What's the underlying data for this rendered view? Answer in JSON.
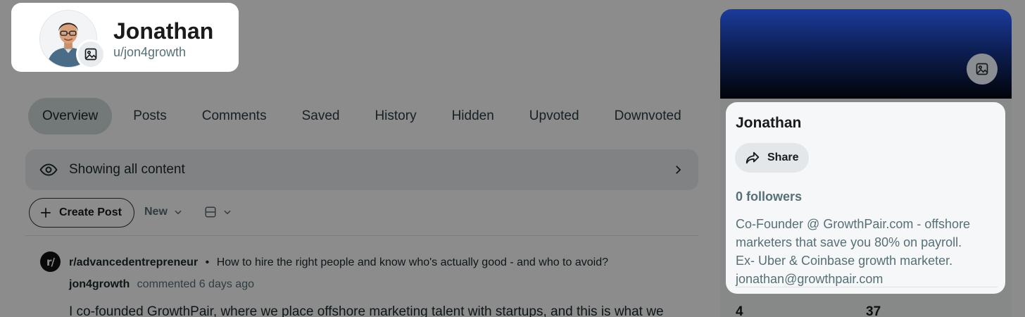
{
  "header": {
    "display_name": "Jonathan",
    "username": "u/jon4growth",
    "avatar_icon": "avatar-photo",
    "avatar_edit_icon": "image-edit-icon"
  },
  "tabs": [
    {
      "label": "Overview",
      "active": true
    },
    {
      "label": "Posts",
      "active": false
    },
    {
      "label": "Comments",
      "active": false
    },
    {
      "label": "Saved",
      "active": false
    },
    {
      "label": "History",
      "active": false
    },
    {
      "label": "Hidden",
      "active": false
    },
    {
      "label": "Upvoted",
      "active": false
    },
    {
      "label": "Downvoted",
      "active": false
    }
  ],
  "content_filter": {
    "label": "Showing all content",
    "icon": "eye-icon"
  },
  "toolbar": {
    "create_post_label": "Create Post",
    "sort_label": "New",
    "view_icon": "card-view-icon"
  },
  "post": {
    "subreddit_icon_text": "r/",
    "subreddit": "r/advancedentrepreneur",
    "separator": "•",
    "title": "How to hire the right people and know who's actually good - and who to avoid?",
    "author": "jon4growth",
    "meta": "commented 6 days ago",
    "body_preview": "I co-founded GrowthPair, where we place offshore marketing talent with startups, and this is what we"
  },
  "sidebar": {
    "banner_edit_icon": "image-edit-icon",
    "name": "Jonathan",
    "share_label": "Share",
    "followers": "0 followers",
    "bio": [
      "Co-Founder @ GrowthPair.com - offshore",
      "marketers that save you 80% on payroll.",
      "Ex- Uber & Coinbase growth marketer.",
      "jonathan@growthpair.com"
    ],
    "stat_1": "4",
    "stat_2": "37"
  },
  "colors": {
    "overlay": "#000000",
    "active_tab": "#d2dadd",
    "banner_top": "#1b3c9b",
    "banner_bottom": "#020409"
  }
}
